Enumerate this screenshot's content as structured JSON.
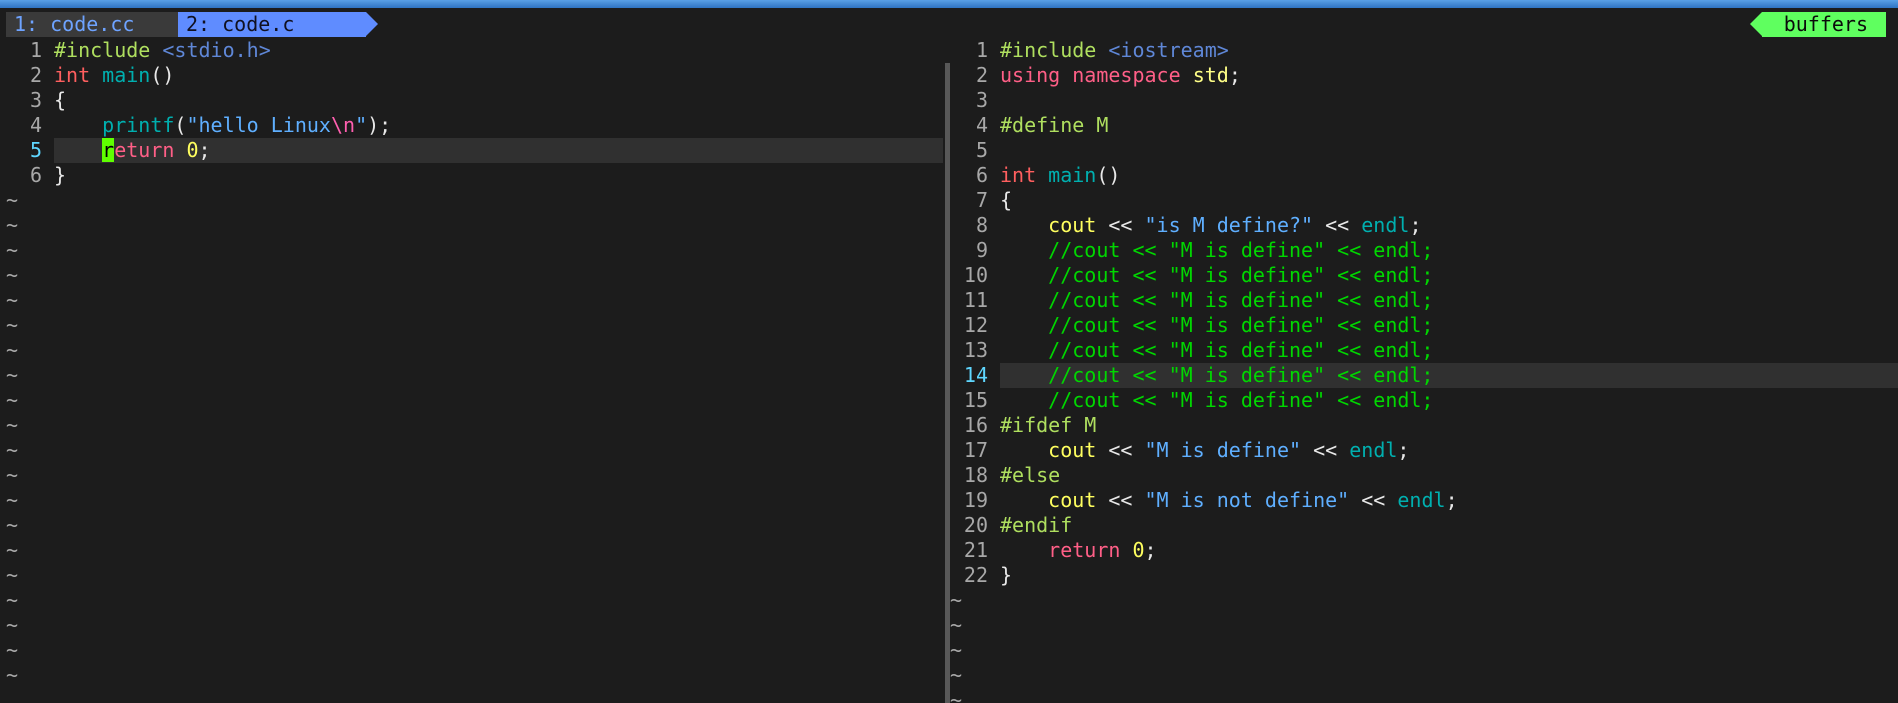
{
  "window": {
    "title_bar_color": "#3c88d8"
  },
  "tabs": [
    {
      "label": "1: code.cc",
      "active": false
    },
    {
      "label": "2: code.c",
      "active": true
    }
  ],
  "buffers_label": "buffers",
  "colors": {
    "tab_active": "#5f8cff",
    "tab_inactive_text": "#6ea3ff",
    "buffers_badge": "#5fff5f",
    "cursor": "#5fff00",
    "background": "#1c1c1c"
  },
  "left_pane": {
    "file": "code.c",
    "cursor_line": 5,
    "lines": [
      {
        "n": "1",
        "tokens": [
          {
            "t": "#include ",
            "c": "pre"
          },
          {
            "t": "<stdio.h>",
            "c": "inc"
          }
        ]
      },
      {
        "n": "2",
        "tokens": [
          {
            "t": "int",
            "c": "type"
          },
          {
            "t": " ",
            "c": "plain"
          },
          {
            "t": "main",
            "c": "fn"
          },
          {
            "t": "()",
            "c": "plain"
          }
        ]
      },
      {
        "n": "3",
        "tokens": [
          {
            "t": "{",
            "c": "plain"
          }
        ]
      },
      {
        "n": "4",
        "tokens": [
          {
            "t": "    ",
            "c": "plain"
          },
          {
            "t": "printf",
            "c": "fn"
          },
          {
            "t": "(",
            "c": "plain"
          },
          {
            "t": "\"hello Linux",
            "c": "str"
          },
          {
            "t": "\\n",
            "c": "esc"
          },
          {
            "t": "\"",
            "c": "str"
          },
          {
            "t": ");",
            "c": "plain"
          }
        ]
      },
      {
        "n": "5",
        "tokens": [
          {
            "t": "    ",
            "c": "plain"
          },
          {
            "t": "r",
            "c": "cursor"
          },
          {
            "t": "eturn",
            "c": "kw"
          },
          {
            "t": " ",
            "c": "plain"
          },
          {
            "t": "0",
            "c": "num"
          },
          {
            "t": ";",
            "c": "plain"
          }
        ]
      },
      {
        "n": "6",
        "tokens": [
          {
            "t": "}",
            "c": "plain"
          }
        ]
      }
    ],
    "tilde_count": 20
  },
  "right_pane": {
    "file": "code.cc",
    "cursor_line": 14,
    "lines": [
      {
        "n": "1",
        "tokens": [
          {
            "t": "#include ",
            "c": "pre"
          },
          {
            "t": "<iostream>",
            "c": "inc"
          }
        ]
      },
      {
        "n": "2",
        "tokens": [
          {
            "t": "using",
            "c": "kw"
          },
          {
            "t": " ",
            "c": "plain"
          },
          {
            "t": "namespace",
            "c": "kw"
          },
          {
            "t": " ",
            "c": "plain"
          },
          {
            "t": "std",
            "c": "ns"
          },
          {
            "t": ";",
            "c": "plain"
          }
        ]
      },
      {
        "n": "3",
        "tokens": []
      },
      {
        "n": "4",
        "tokens": [
          {
            "t": "#define M",
            "c": "pre"
          }
        ]
      },
      {
        "n": "5",
        "tokens": []
      },
      {
        "n": "6",
        "tokens": [
          {
            "t": "int",
            "c": "type"
          },
          {
            "t": " ",
            "c": "plain"
          },
          {
            "t": "main",
            "c": "fn"
          },
          {
            "t": "()",
            "c": "plain"
          }
        ]
      },
      {
        "n": "7",
        "tokens": [
          {
            "t": "{",
            "c": "plain"
          }
        ]
      },
      {
        "n": "8",
        "tokens": [
          {
            "t": "    ",
            "c": "plain"
          },
          {
            "t": "cout",
            "c": "id"
          },
          {
            "t": " << ",
            "c": "plain"
          },
          {
            "t": "\"is M define?\"",
            "c": "str"
          },
          {
            "t": " << ",
            "c": "plain"
          },
          {
            "t": "endl",
            "c": "fn"
          },
          {
            "t": ";",
            "c": "plain"
          }
        ]
      },
      {
        "n": "9",
        "tokens": [
          {
            "t": "    //cout << \"M is define\" << endl;",
            "c": "cmt"
          }
        ]
      },
      {
        "n": "10",
        "tokens": [
          {
            "t": "    //cout << \"M is define\" << endl;",
            "c": "cmt"
          }
        ]
      },
      {
        "n": "11",
        "tokens": [
          {
            "t": "    //cout << \"M is define\" << endl;",
            "c": "cmt"
          }
        ]
      },
      {
        "n": "12",
        "tokens": [
          {
            "t": "    //cout << \"M is define\" << endl;",
            "c": "cmt"
          }
        ]
      },
      {
        "n": "13",
        "tokens": [
          {
            "t": "    //cout << \"M is define\" << endl;",
            "c": "cmt"
          }
        ]
      },
      {
        "n": "14",
        "tokens": [
          {
            "t": "    //cout << \"M is define\" << endl;",
            "c": "cmt"
          }
        ]
      },
      {
        "n": "15",
        "tokens": [
          {
            "t": "    //cout << \"M is define\" << endl;",
            "c": "cmt"
          }
        ]
      },
      {
        "n": "16",
        "tokens": [
          {
            "t": "#ifdef M",
            "c": "pre"
          }
        ]
      },
      {
        "n": "17",
        "tokens": [
          {
            "t": "    ",
            "c": "plain"
          },
          {
            "t": "cout",
            "c": "id"
          },
          {
            "t": " << ",
            "c": "plain"
          },
          {
            "t": "\"M is define\"",
            "c": "str"
          },
          {
            "t": " << ",
            "c": "plain"
          },
          {
            "t": "endl",
            "c": "fn"
          },
          {
            "t": ";",
            "c": "plain"
          }
        ]
      },
      {
        "n": "18",
        "tokens": [
          {
            "t": "#else",
            "c": "pre"
          }
        ]
      },
      {
        "n": "19",
        "tokens": [
          {
            "t": "    ",
            "c": "plain"
          },
          {
            "t": "cout",
            "c": "id"
          },
          {
            "t": " << ",
            "c": "plain"
          },
          {
            "t": "\"M is not define\"",
            "c": "str"
          },
          {
            "t": " << ",
            "c": "plain"
          },
          {
            "t": "endl",
            "c": "fn"
          },
          {
            "t": ";",
            "c": "plain"
          }
        ]
      },
      {
        "n": "20",
        "tokens": [
          {
            "t": "#endif",
            "c": "pre"
          }
        ]
      },
      {
        "n": "21",
        "tokens": [
          {
            "t": "    ",
            "c": "plain"
          },
          {
            "t": "return",
            "c": "kw"
          },
          {
            "t": " ",
            "c": "plain"
          },
          {
            "t": "0",
            "c": "num"
          },
          {
            "t": ";",
            "c": "plain"
          }
        ]
      },
      {
        "n": "22",
        "tokens": [
          {
            "t": "}",
            "c": "plain"
          }
        ]
      }
    ],
    "tilde_count": 5
  }
}
